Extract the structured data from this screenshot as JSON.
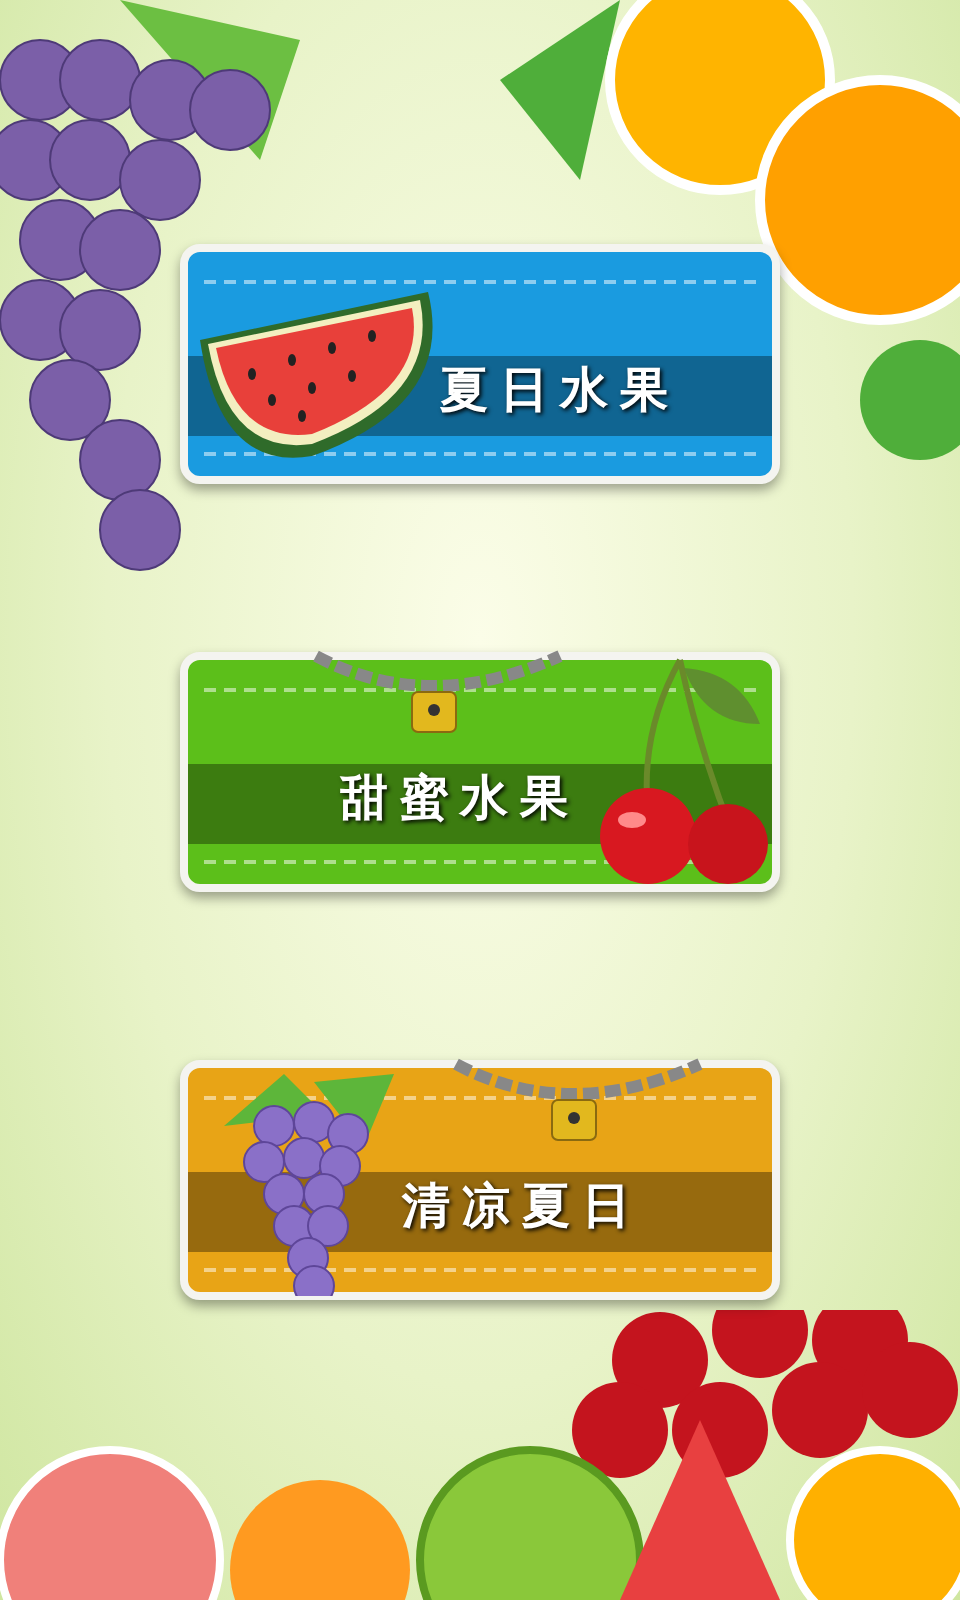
{
  "levels": [
    {
      "title": "夏日水果",
      "kind": "watermelon",
      "color": "#1a9be0",
      "locked": false
    },
    {
      "title": "甜蜜水果",
      "kind": "cherry",
      "color": "#5cbf1a",
      "locked": true
    },
    {
      "title": "清凉夏日",
      "kind": "grape",
      "color": "#e8a416",
      "locked": true
    }
  ]
}
